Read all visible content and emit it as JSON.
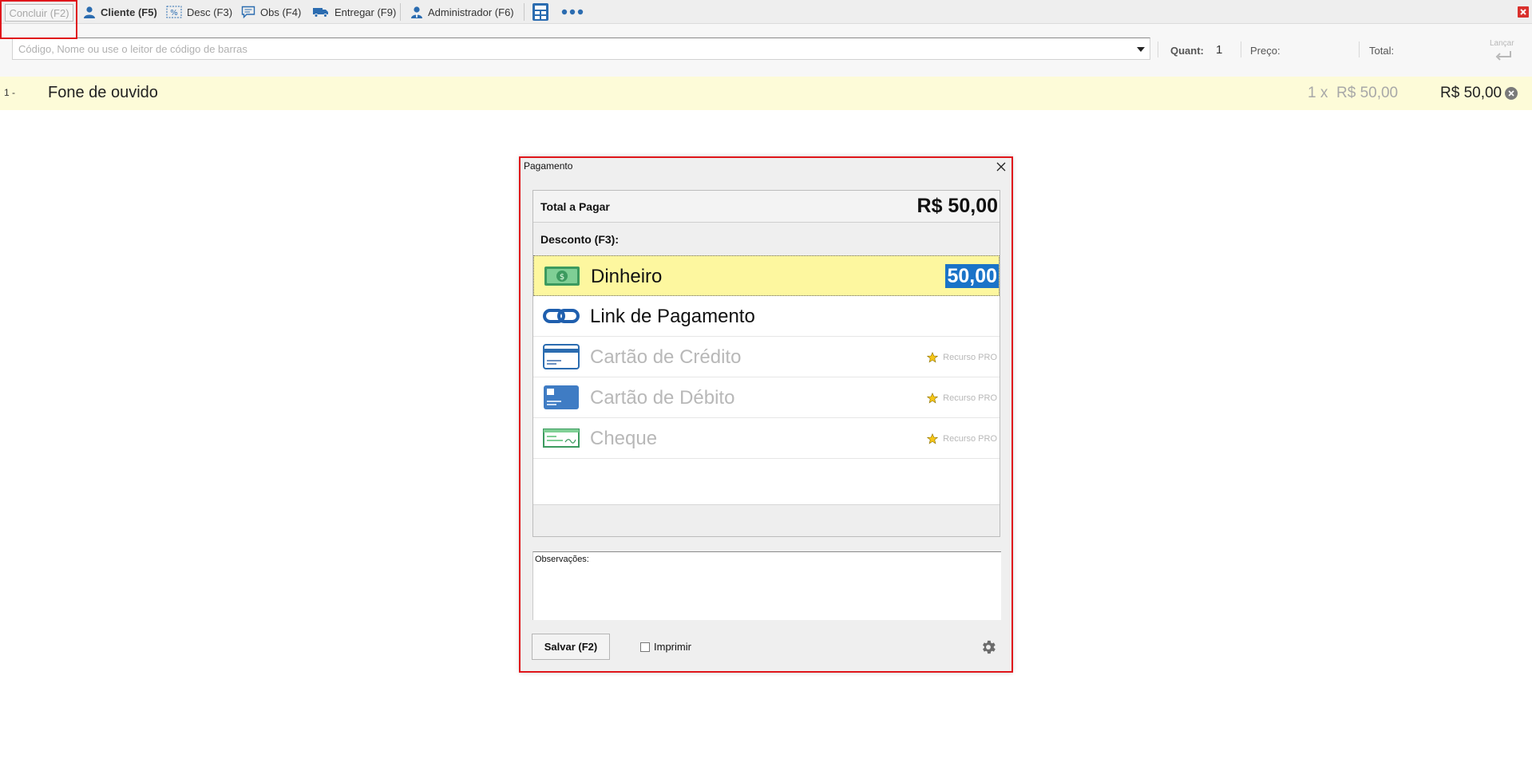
{
  "toolbar": {
    "concluir_label": "Concluir (F2)",
    "cliente_label": "Cliente (F5)",
    "desc_label": "Desc (F3)",
    "obs_label": "Obs (F4)",
    "entregar_label": "Entregar (F9)",
    "admin_label": "Administrador (F6)"
  },
  "entry": {
    "placeholder": "Código, Nome ou use o leitor de código de barras",
    "quant_label": "Quant:",
    "quant_value": "1",
    "preco_label": "Preço:",
    "total_label": "Total:",
    "lancar_label": "Lançar"
  },
  "item": {
    "number": "1 -",
    "name": "Fone de ouvido",
    "qty": "1  x",
    "unit_price": "R$ 50,00",
    "total": "R$ 50,00"
  },
  "dialog": {
    "title": "Pagamento",
    "total_label": "Total a Pagar",
    "total_value": "R$ 50,00",
    "desconto_label": "Desconto (F3):",
    "methods": [
      {
        "label": "Dinheiro",
        "amount": "50,00"
      },
      {
        "label": "Link de Pagamento"
      },
      {
        "label": "Cartão de Crédito",
        "badge": "Recurso PRO"
      },
      {
        "label": "Cartão de Débito",
        "badge": "Recurso PRO"
      },
      {
        "label": "Cheque",
        "badge": "Recurso PRO"
      }
    ],
    "obs_label": "Observações:",
    "save_label": "Salvar (F2)",
    "print_label": "Imprimir"
  },
  "colors": {
    "accent_red": "#e0161b",
    "selection_yellow": "#fdf79f",
    "row_yellow": "#fdfbd8",
    "amount_blue": "#1a73c8",
    "icon_blue": "#2b6cb0"
  }
}
